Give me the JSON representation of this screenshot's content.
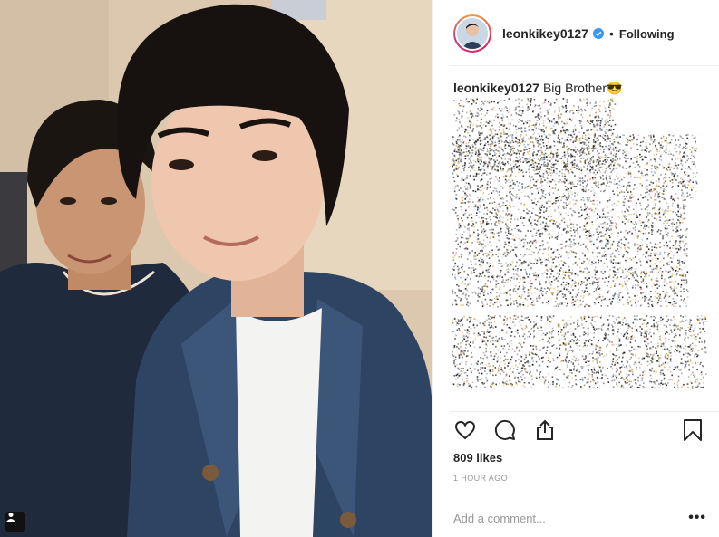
{
  "post": {
    "author": {
      "username": "leonkikey0127",
      "verified": true,
      "follow_state": "Following",
      "separator": "•"
    },
    "photo": {
      "description_icon": "tagged-people-icon"
    },
    "caption": {
      "username": "leonkikey0127",
      "text": "Big Brother😎"
    },
    "actions": {
      "like_icon": "heart-icon",
      "comment_icon": "comment-icon",
      "share_icon": "share-icon",
      "save_icon": "bookmark-icon"
    },
    "likes": "809 likes",
    "timestamp": "1 HOUR AGO",
    "comment": {
      "placeholder": "Add a comment...",
      "more_label": "•••"
    }
  },
  "colors": {
    "text": "#262626",
    "muted": "#999999",
    "verified_blue": "#3897f0",
    "divider": "#efefef"
  }
}
